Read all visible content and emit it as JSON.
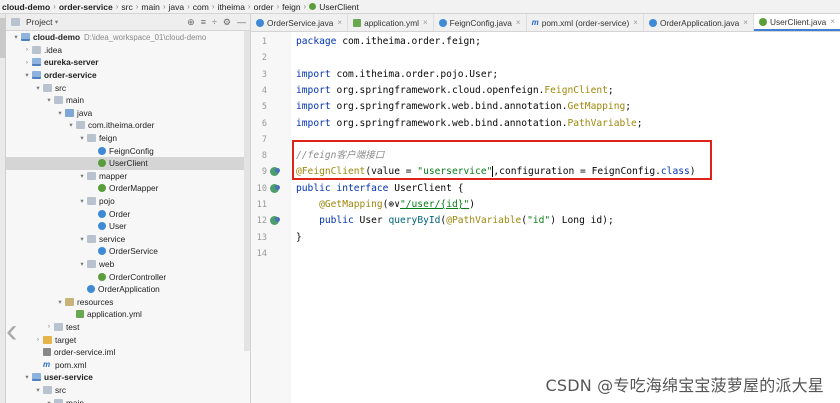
{
  "breadcrumbs": [
    "cloud-demo",
    "order-service",
    "src",
    "main",
    "java",
    "com",
    "itheima",
    "order",
    "feign",
    "UserClient"
  ],
  "project_panel": {
    "title": "Project",
    "tree": [
      {
        "label": "cloud-demo",
        "path": "D:\\idea_workspace_01\\cloud-demo",
        "depth": 0,
        "icon": "module",
        "arrow": "down",
        "bold": true
      },
      {
        "label": ".idea",
        "depth": 1,
        "icon": "folder",
        "arrow": "right"
      },
      {
        "label": "eureka-server",
        "depth": 1,
        "icon": "module",
        "arrow": "right",
        "bold": true
      },
      {
        "label": "order-service",
        "depth": 1,
        "icon": "module",
        "arrow": "down",
        "bold": true
      },
      {
        "label": "src",
        "depth": 2,
        "icon": "folder",
        "arrow": "down"
      },
      {
        "label": "main",
        "depth": 3,
        "icon": "folder",
        "arrow": "down"
      },
      {
        "label": "java",
        "depth": 4,
        "icon": "folder-src",
        "arrow": "down"
      },
      {
        "label": "com.itheima.order",
        "depth": 5,
        "icon": "package",
        "arrow": "down"
      },
      {
        "label": "feign",
        "depth": 6,
        "icon": "package",
        "arrow": "down"
      },
      {
        "label": "FeignConfig",
        "depth": 7,
        "icon": "class",
        "arrow": ""
      },
      {
        "label": "UserClient",
        "depth": 7,
        "icon": "interface",
        "arrow": "",
        "selected": true
      },
      {
        "label": "mapper",
        "depth": 6,
        "icon": "package",
        "arrow": "down"
      },
      {
        "label": "OrderMapper",
        "depth": 7,
        "icon": "interface",
        "arrow": ""
      },
      {
        "label": "pojo",
        "depth": 6,
        "icon": "package",
        "arrow": "down"
      },
      {
        "label": "Order",
        "depth": 7,
        "icon": "class",
        "arrow": ""
      },
      {
        "label": "User",
        "depth": 7,
        "icon": "class",
        "arrow": ""
      },
      {
        "label": "service",
        "depth": 6,
        "icon": "package",
        "arrow": "down"
      },
      {
        "label": "OrderService",
        "depth": 7,
        "icon": "class",
        "arrow": ""
      },
      {
        "label": "web",
        "depth": 6,
        "icon": "package",
        "arrow": "down"
      },
      {
        "label": "OrderController",
        "depth": 7,
        "icon": "interface",
        "arrow": ""
      },
      {
        "label": "OrderApplication",
        "depth": 6,
        "icon": "class",
        "arrow": ""
      },
      {
        "label": "resources",
        "depth": 4,
        "icon": "folder-res",
        "arrow": "down"
      },
      {
        "label": "application.yml",
        "depth": 5,
        "icon": "yml",
        "arrow": ""
      },
      {
        "label": "test",
        "depth": 3,
        "icon": "folder",
        "arrow": "right"
      },
      {
        "label": "target",
        "depth": 2,
        "icon": "folder-target",
        "arrow": "right"
      },
      {
        "label": "order-service.iml",
        "depth": 2,
        "icon": "iml",
        "arrow": ""
      },
      {
        "label": "pom.xml",
        "depth": 2,
        "icon": "m",
        "arrow": ""
      },
      {
        "label": "user-service",
        "depth": 1,
        "icon": "module",
        "arrow": "down",
        "bold": true
      },
      {
        "label": "src",
        "depth": 2,
        "icon": "folder",
        "arrow": "down"
      },
      {
        "label": "main",
        "depth": 3,
        "icon": "folder",
        "arrow": "down"
      }
    ]
  },
  "tabs": [
    {
      "label": "OrderService.java",
      "icon": "class"
    },
    {
      "label": "application.yml",
      "icon": "yml"
    },
    {
      "label": "FeignConfig.java",
      "icon": "class"
    },
    {
      "label": "pom.xml (order-service)",
      "icon": "m"
    },
    {
      "label": "OrderApplication.java",
      "icon": "class"
    },
    {
      "label": "UserClient.java",
      "icon": "interface",
      "active": true
    }
  ],
  "editor": {
    "lines": [
      {
        "n": "1",
        "tokens": [
          [
            "kw",
            "package "
          ],
          [
            "",
            "com.itheima.order.feign;"
          ]
        ]
      },
      {
        "n": "2",
        "tokens": []
      },
      {
        "n": "3",
        "tokens": [
          [
            "kw",
            "import "
          ],
          [
            "",
            "com.itheima.order.pojo.User;"
          ]
        ]
      },
      {
        "n": "4",
        "tokens": [
          [
            "kw",
            "import "
          ],
          [
            "",
            "org.springframework.cloud.openfeign."
          ],
          [
            "ann",
            "FeignClient"
          ],
          [
            "",
            ";"
          ]
        ]
      },
      {
        "n": "5",
        "tokens": [
          [
            "kw",
            "import "
          ],
          [
            "",
            "org.springframework.web.bind.annotation."
          ],
          [
            "ann",
            "GetMapping"
          ],
          [
            "",
            ";"
          ]
        ]
      },
      {
        "n": "6",
        "tokens": [
          [
            "kw",
            "import "
          ],
          [
            "",
            "org.springframework.web.bind.annotation."
          ],
          [
            "ann",
            "PathVariable"
          ],
          [
            "",
            ";"
          ]
        ]
      },
      {
        "n": "7",
        "tokens": []
      },
      {
        "n": "8",
        "tokens": [
          [
            "cmt",
            "//feign客户端接口"
          ]
        ]
      },
      {
        "n": "9",
        "tokens": [
          [
            "ann",
            "@FeignClient"
          ],
          [
            "",
            "(value = "
          ],
          [
            "str",
            "\"userservice\""
          ],
          [
            "caret",
            ""
          ],
          [
            "",
            ",configuration = FeignConfig."
          ],
          [
            "kw",
            "class"
          ],
          [
            "",
            ")"
          ]
        ],
        "gutter": "bean"
      },
      {
        "n": "10",
        "tokens": [
          [
            "kw",
            "public interface "
          ],
          [
            "",
            "UserClient {"
          ]
        ],
        "gutter": "bean"
      },
      {
        "n": "11",
        "tokens": [
          [
            "",
            "    "
          ],
          [
            "ann",
            "@GetMapping"
          ],
          [
            "",
            "(⊚∨"
          ],
          [
            "link",
            "\"/user/{id}\""
          ],
          [
            "",
            ")"
          ]
        ]
      },
      {
        "n": "12",
        "tokens": [
          [
            "",
            "    "
          ],
          [
            "kw",
            "public "
          ],
          [
            "",
            "User "
          ],
          [
            "method",
            "queryById"
          ],
          [
            "",
            "("
          ],
          [
            "ann",
            "@PathVariable"
          ],
          [
            "",
            "("
          ],
          [
            "str",
            "\"id\""
          ],
          [
            "",
            ") Long id);"
          ]
        ],
        "gutter": "bean"
      },
      {
        "n": "13",
        "tokens": [
          [
            "",
            "}"
          ]
        ]
      },
      {
        "n": "14",
        "tokens": []
      }
    ]
  },
  "watermark": "CSDN @专吃海绵宝宝菠萝屋的派大星"
}
